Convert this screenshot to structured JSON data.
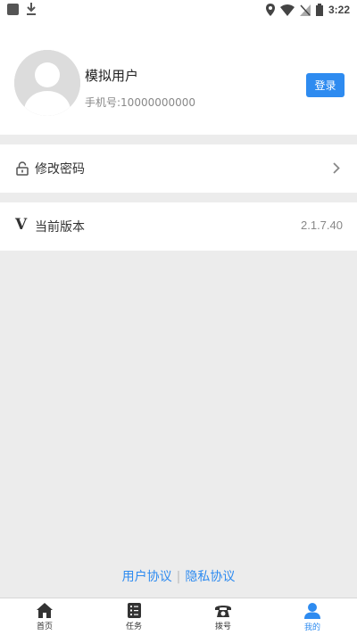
{
  "status_bar": {
    "time": "3:22"
  },
  "profile": {
    "username": "模拟用户",
    "phone": "手机号:10000000000",
    "login_label": "登录"
  },
  "menu": {
    "change_password": "修改密码",
    "current_version_label": "当前版本",
    "version_value": "2.1.7.40"
  },
  "footer": {
    "user_agreement": "用户协议",
    "separator": "|",
    "privacy_agreement": "隐私协议"
  },
  "tabs": [
    {
      "label": "首页",
      "icon": "home-icon",
      "active": false
    },
    {
      "label": "任务",
      "icon": "task-icon",
      "active": false
    },
    {
      "label": "拨号",
      "icon": "phone-icon",
      "active": false
    },
    {
      "label": "我的",
      "icon": "user-icon",
      "active": true
    }
  ],
  "colors": {
    "accent": "#2e8bf0",
    "background": "#ececec"
  }
}
